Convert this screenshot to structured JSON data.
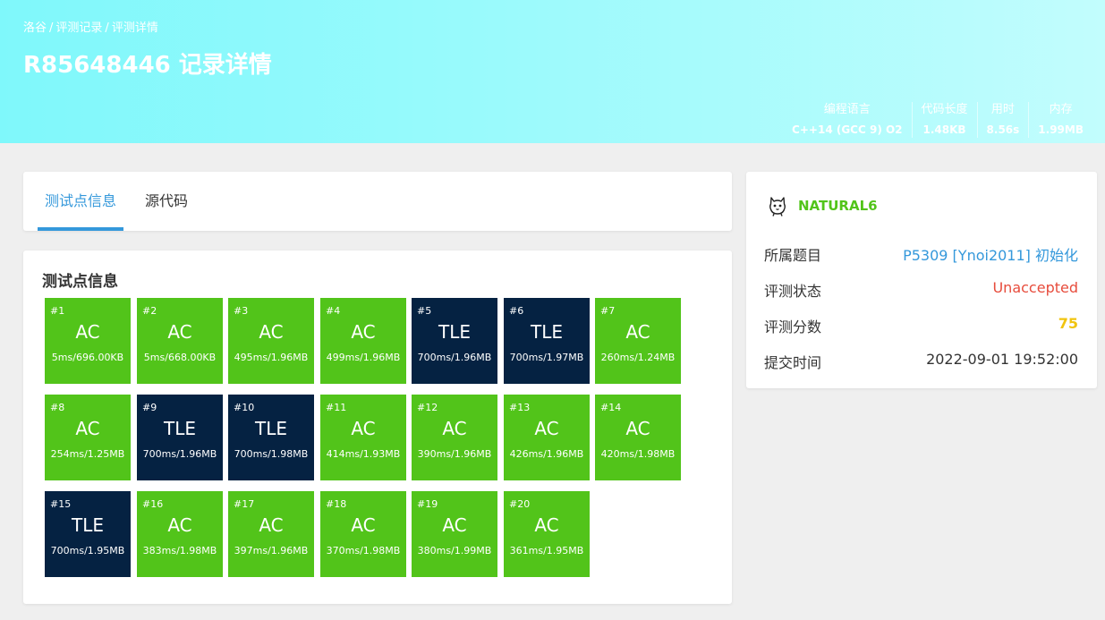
{
  "header": {
    "breadcrumb": [
      "洛谷",
      "评测记录",
      "评测详情"
    ],
    "title": "R85648446 记录详情",
    "stats": [
      {
        "label": "编程语言",
        "value": "C++14 (GCC 9) O2"
      },
      {
        "label": "代码长度",
        "value": "1.48KB"
      },
      {
        "label": "用时",
        "value": "8.56s"
      },
      {
        "label": "内存",
        "value": "1.99MB"
      }
    ]
  },
  "tabs": [
    {
      "label": "测试点信息",
      "active": true
    },
    {
      "label": "源代码",
      "active": false
    }
  ],
  "cases_section": {
    "title": "测试点信息",
    "cases": [
      {
        "num": "#1",
        "status": "AC",
        "info": "5ms/696.00KB"
      },
      {
        "num": "#2",
        "status": "AC",
        "info": "5ms/668.00KB"
      },
      {
        "num": "#3",
        "status": "AC",
        "info": "495ms/1.96MB"
      },
      {
        "num": "#4",
        "status": "AC",
        "info": "499ms/1.96MB"
      },
      {
        "num": "#5",
        "status": "TLE",
        "info": "700ms/1.96MB"
      },
      {
        "num": "#6",
        "status": "TLE",
        "info": "700ms/1.97MB"
      },
      {
        "num": "#7",
        "status": "AC",
        "info": "260ms/1.24MB"
      },
      {
        "num": "#8",
        "status": "AC",
        "info": "254ms/1.25MB"
      },
      {
        "num": "#9",
        "status": "TLE",
        "info": "700ms/1.96MB"
      },
      {
        "num": "#10",
        "status": "TLE",
        "info": "700ms/1.98MB"
      },
      {
        "num": "#11",
        "status": "AC",
        "info": "414ms/1.93MB"
      },
      {
        "num": "#12",
        "status": "AC",
        "info": "390ms/1.96MB"
      },
      {
        "num": "#13",
        "status": "AC",
        "info": "426ms/1.96MB"
      },
      {
        "num": "#14",
        "status": "AC",
        "info": "420ms/1.98MB"
      },
      {
        "num": "#15",
        "status": "TLE",
        "info": "700ms/1.95MB"
      },
      {
        "num": "#16",
        "status": "AC",
        "info": "383ms/1.98MB"
      },
      {
        "num": "#17",
        "status": "AC",
        "info": "397ms/1.96MB"
      },
      {
        "num": "#18",
        "status": "AC",
        "info": "370ms/1.98MB"
      },
      {
        "num": "#19",
        "status": "AC",
        "info": "380ms/1.99MB"
      },
      {
        "num": "#20",
        "status": "AC",
        "info": "361ms/1.95MB"
      }
    ]
  },
  "record": {
    "username": "NATURAL6",
    "user_icon": "cat-avatar-icon",
    "rows": [
      {
        "key": "所属题目",
        "value": "P5309 [Ynoi2011] 初始化"
      },
      {
        "key": "评测状态",
        "value": "Unaccepted"
      },
      {
        "key": "评测分数",
        "value": "75"
      },
      {
        "key": "提交时间",
        "value": "2022-09-01 19:52:00"
      }
    ]
  },
  "colors": {
    "accepted": "#52c41a",
    "time_limit_exceeded": "#052242",
    "link": "#3498db",
    "unaccepted": "#e74c3c",
    "score": "#f1c40f"
  }
}
